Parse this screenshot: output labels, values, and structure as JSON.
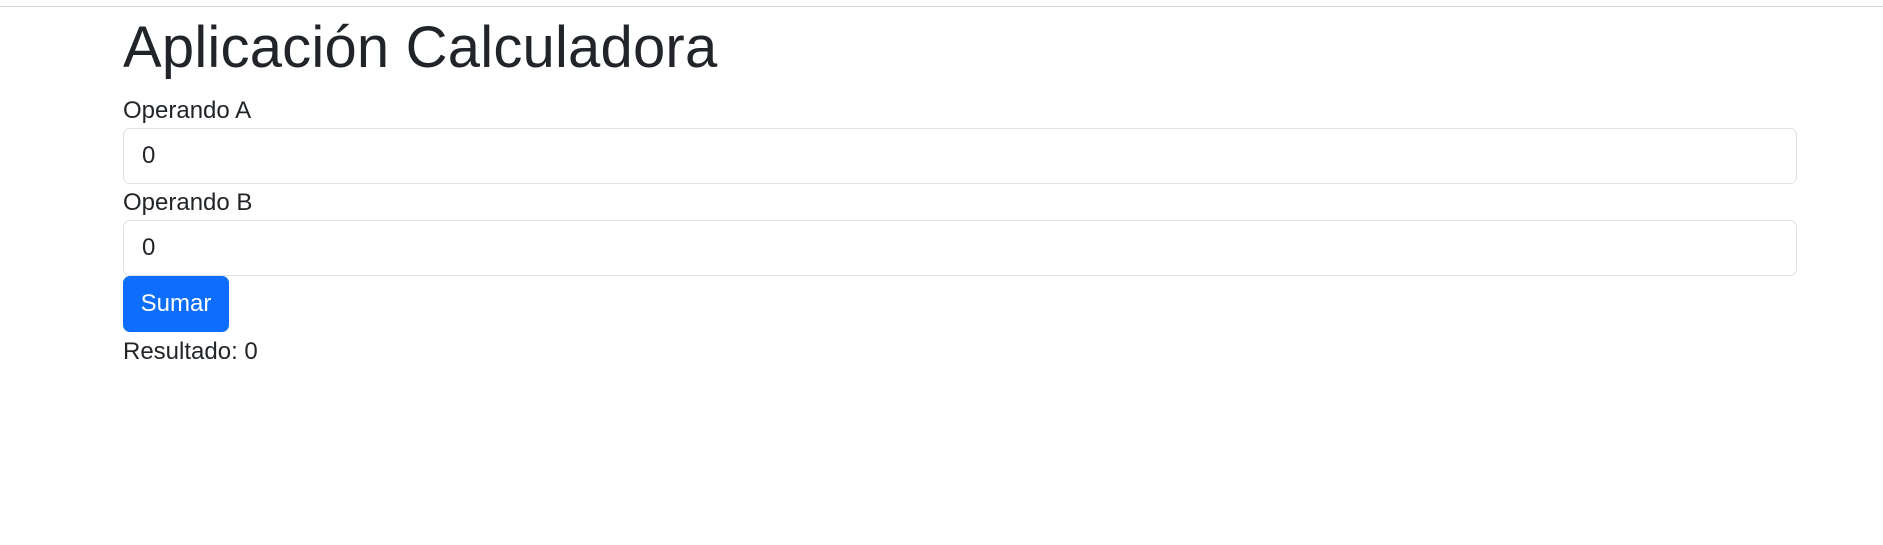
{
  "page": {
    "title": "Aplicación Calculadora"
  },
  "form": {
    "operand_a": {
      "label": "Operando A",
      "value": "0"
    },
    "operand_b": {
      "label": "Operando B",
      "value": "0"
    },
    "submit_label": "Sumar"
  },
  "result": {
    "text": "Resultado: 0"
  },
  "colors": {
    "primary_button": "#0d6efd",
    "text": "#212529",
    "input_border": "#dee2e6"
  }
}
